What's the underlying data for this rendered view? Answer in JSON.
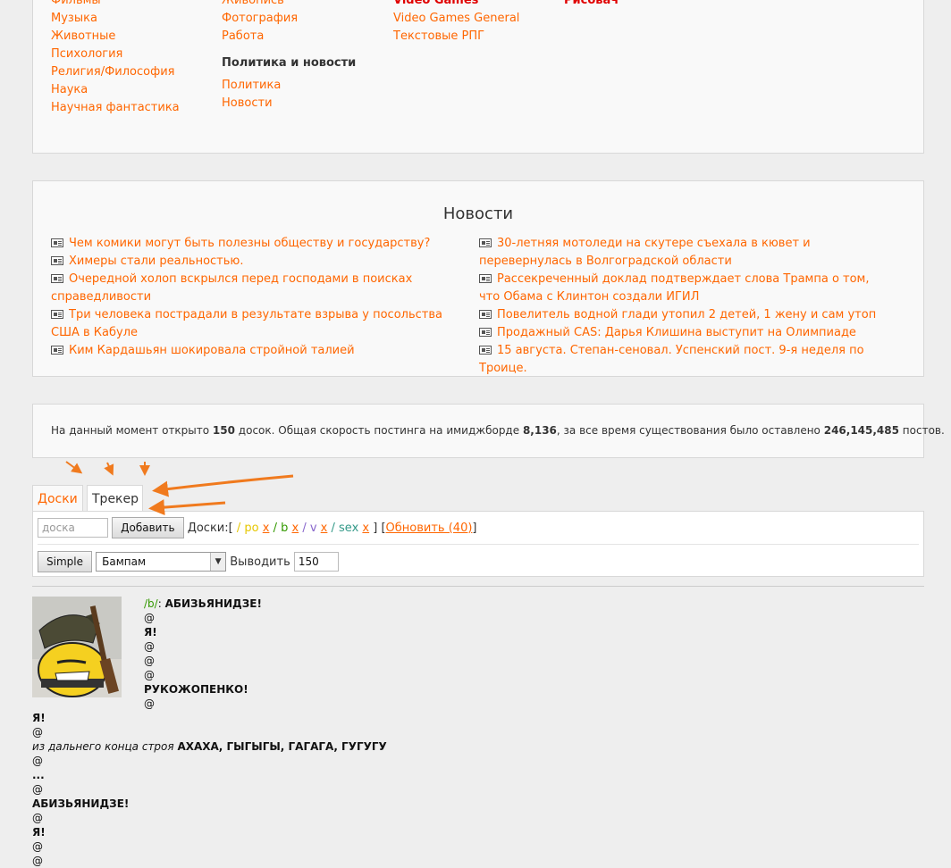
{
  "categories": {
    "col1": [
      "Фильмы",
      "Музыка",
      "Животные",
      "Психология",
      "Религия/Философия",
      "Наука",
      "Научная фантастика"
    ],
    "col2": {
      "links_top": [
        "Живопись",
        "Фотография",
        "Работа"
      ],
      "header": "Политика и новости",
      "links_bottom": [
        "Политика",
        "Новости"
      ]
    },
    "col3": {
      "header_red": "Video Games",
      "links": [
        "Video Games General",
        "Текстовые РПГ"
      ]
    },
    "col4": {
      "header_red": "Рисовач"
    }
  },
  "news": {
    "title": "Новости",
    "left": [
      "Чем комики могут быть полезны обществу и государству?",
      "Химеры стали реальностью.",
      "Очередной холоп вскрылся перед господами в поисках справедливости",
      "Три человека пострадали в результате взрыва у посольства США в Кабуле",
      "Ким Кардашьян шокировала стройной талией"
    ],
    "right": [
      "30-летняя мотоледи на скутере съехала в кювет и перевернулась в Волгоградской области",
      "Рассекреченный доклад подтверждает слова Трампа о том, что Обама с Клинтон создали ИГИЛ",
      "Повелитель водной глади утопил 2 детей, 1 жену и сам утоп",
      "Продажный CAS: Дарья Клишина выступит на Олимпиаде",
      "15 августа. Степан-сеновал. Успенский пост. 9-я неделя по Троице."
    ]
  },
  "stats": {
    "prefix": "На данный момент открыто ",
    "boards": "150",
    "mid1": " досок. Общая скорость постинга на имиджборде ",
    "speed": "8,136",
    "mid2": ", за все время существования было оставлено ",
    "posts": "246,145,485",
    "suffix": " постов."
  },
  "tabs": {
    "boards": "Доски",
    "tracker": "Трекер"
  },
  "tracker": {
    "board_placeholder": "доска",
    "add_label": "Добавить",
    "boards_label": "Доски: ",
    "bracket_open": "[ ",
    "bracket_close": " ]",
    "board_list": [
      {
        "name": "/ po",
        "color": "#e6c700"
      },
      {
        "name": "/ b",
        "color": "#339900"
      },
      {
        "name": "/ v",
        "color": "#8866cc"
      },
      {
        "name": "/ sex",
        "color": "#339988"
      }
    ],
    "remove_label": "x",
    "refresh_label": "Обновить (40)",
    "mode_label": "Simple",
    "sort_value": "Бампам",
    "show_label": "Выводить",
    "show_value": "150"
  },
  "post": {
    "board": "/b/",
    "colon": ": ",
    "top_lines": [
      {
        "text": "АБИЗЬЯНИДЗЕ!",
        "bold": true
      },
      {
        "text": "@",
        "bold": false
      },
      {
        "text": "Я!",
        "bold": true
      },
      {
        "text": "@",
        "bold": false
      },
      {
        "text": "@",
        "bold": false
      },
      {
        "text": "@",
        "bold": false
      },
      {
        "text": "РУКОЖОПЕНКО!",
        "bold": true
      },
      {
        "text": "@",
        "bold": false
      }
    ],
    "bottom_lines": [
      {
        "text": "Я!",
        "bold": true
      },
      {
        "text": "@",
        "bold": false
      },
      {
        "italic": "из дальнего конца строя ",
        "text": "АХАХА, ГЫГЫГЫ, ГАГАГА, ГУГУГУ",
        "bold": true
      },
      {
        "text": "@",
        "bold": false
      },
      {
        "text": "...",
        "bold": true
      },
      {
        "text": "@",
        "bold": false
      },
      {
        "text": "АБИЗЬЯНИДЗЕ!",
        "bold": true
      },
      {
        "text": "@",
        "bold": false
      },
      {
        "text": "Я!",
        "bold": true
      },
      {
        "text": "@",
        "bold": false
      },
      {
        "text": "@",
        "bold": false
      }
    ]
  },
  "colors": {
    "accent": "#ff6600",
    "red": "#e00000",
    "arrow": "#f07a1e"
  }
}
